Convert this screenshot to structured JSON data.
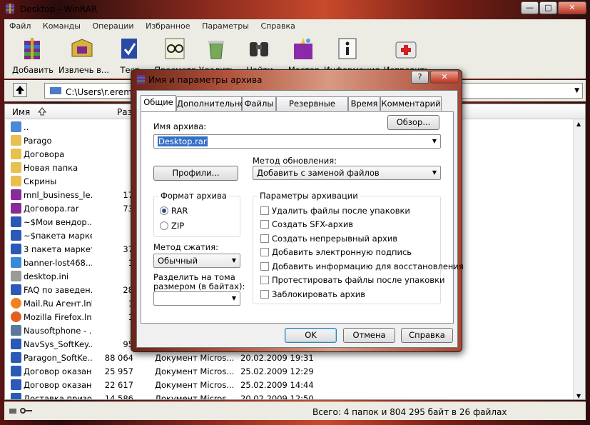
{
  "window": {
    "title": "Desktop - WinRAR",
    "minimize": "—",
    "maximize": "□",
    "close": "✕"
  },
  "menu": [
    "Файл",
    "Команды",
    "Операции",
    "Избранное",
    "Параметры",
    "Справка"
  ],
  "toolbar": [
    {
      "label": "Добавить",
      "icon": "add-archive-icon"
    },
    {
      "label": "Извлечь в...",
      "icon": "extract-icon"
    },
    {
      "label": "Тест",
      "icon": "test-icon"
    },
    {
      "label": "Просмотр",
      "icon": "view-icon"
    },
    {
      "label": "Удалить",
      "icon": "delete-icon"
    },
    {
      "label": "Найти",
      "icon": "find-icon"
    },
    {
      "label": "Мастер",
      "icon": "wizard-icon"
    },
    {
      "label": "Информация",
      "icon": "info-icon"
    },
    {
      "label": "Исправить",
      "icon": "repair-icon"
    }
  ],
  "address": {
    "path": "C:\\Users\\r.eremin\\Desktop"
  },
  "list": {
    "headers": {
      "name": "Имя",
      "size": "Раз"
    },
    "rows": [
      {
        "name": "..",
        "size": "",
        "type": "",
        "date": "",
        "icon": "folder-up-icon"
      },
      {
        "name": "Parago",
        "size": "",
        "type": "",
        "date": "",
        "icon": "folder-icon"
      },
      {
        "name": "Договора",
        "size": "",
        "type": "",
        "date": "",
        "icon": "folder-icon"
      },
      {
        "name": "Новая папка",
        "size": "",
        "type": "",
        "date": "",
        "icon": "folder-icon"
      },
      {
        "name": "Скрины",
        "size": "",
        "type": "",
        "date": "",
        "icon": "folder-icon"
      },
      {
        "name": "mnl_business_le...",
        "size": "17",
        "type": "",
        "date": "",
        "icon": "rar-file-icon"
      },
      {
        "name": "Договора.rar",
        "size": "73",
        "type": "",
        "date": "",
        "icon": "rar-file-icon"
      },
      {
        "name": "~$Мои вендор...",
        "size": "",
        "type": "",
        "date": "",
        "icon": "doc-file-icon"
      },
      {
        "name": "~$пакета марке...",
        "size": "",
        "type": "",
        "date": "",
        "icon": "doc-file-icon"
      },
      {
        "name": "3 пакета маркет...",
        "size": "37",
        "type": "",
        "date": "",
        "icon": "doc-file-icon"
      },
      {
        "name": "banner-lost468....",
        "size": "1",
        "type": "",
        "date": "",
        "icon": "ie-file-icon"
      },
      {
        "name": "desktop.ini",
        "size": "",
        "type": "",
        "date": "",
        "icon": "ini-file-icon"
      },
      {
        "name": "FAQ по заведен...",
        "size": "28",
        "type": "",
        "date": "",
        "icon": "doc-file-icon"
      },
      {
        "name": "Mail.Ru Агент.lnk",
        "size": "1",
        "type": "",
        "date": "",
        "icon": "mailru-icon"
      },
      {
        "name": "Mozilla Firefox.lnk",
        "size": "1",
        "type": "",
        "date": "",
        "icon": "firefox-icon"
      },
      {
        "name": "Nausoftphone - ...",
        "size": "",
        "type": "",
        "date": "",
        "icon": "shortcut-icon"
      },
      {
        "name": "NavSys_SoftKey...",
        "size": "95",
        "type": "",
        "date": "",
        "icon": "doc-file-icon"
      },
      {
        "name": "Paragon_SoftKe...",
        "size": "88 064",
        "type": "Документ Micros...",
        "date": "20.02.2009 19:31",
        "icon": "doc-file-icon"
      },
      {
        "name": "Договор оказан...",
        "size": "25 957",
        "type": "Документ Micros...",
        "date": "25.02.2009 12:29",
        "icon": "doc-file-icon"
      },
      {
        "name": "Договор оказан...",
        "size": "22 617",
        "type": "Документ Micros...",
        "date": "25.02.2009 14:44",
        "icon": "doc-file-icon"
      },
      {
        "name": "Доставка призо...",
        "size": "14 586",
        "type": "Документ Micros...",
        "date": "20.02.2009 12:50",
        "icon": "doc-file-icon"
      }
    ]
  },
  "status": {
    "text": "Всего: 4 папок и 804 295 байт в 26 файлах"
  },
  "dialog": {
    "title": "Имя и параметры архива",
    "help": "?",
    "close": "✕",
    "tabs": [
      "Общие",
      "Дополнительно",
      "Файлы",
      "Резервные копии",
      "Время",
      "Комментарий"
    ],
    "archive_name_label": "Имя архива:",
    "browse": "Обзор...",
    "archive_name": "Desktop.rar",
    "update_method_label": "Метод обновления:",
    "update_method": "Добавить с заменой файлов",
    "profiles": "Профили...",
    "format_label": "Формат архива",
    "format_rar": "RAR",
    "format_zip": "ZIP",
    "compression_label": "Метод сжатия:",
    "compression": "Обычный",
    "split_label_1": "Разделить на тома",
    "split_label_2": "размером (в байтах):",
    "split_value": "",
    "options_label": "Параметры архивации",
    "options": [
      {
        "label": "Удалить файлы после упаковки",
        "checked": false
      },
      {
        "label": "Создать SFX-архив",
        "checked": false
      },
      {
        "label": "Создать непрерывный архив",
        "checked": false
      },
      {
        "label": "Добавить электронную подпись",
        "checked": false
      },
      {
        "label": "Добавить информацию для восстановления",
        "checked": false
      },
      {
        "label": "Протестировать файлы после упаковки",
        "checked": false
      },
      {
        "label": "Заблокировать архив",
        "checked": false
      }
    ],
    "ok": "OK",
    "cancel": "Отмена",
    "help_btn": "Справка"
  }
}
